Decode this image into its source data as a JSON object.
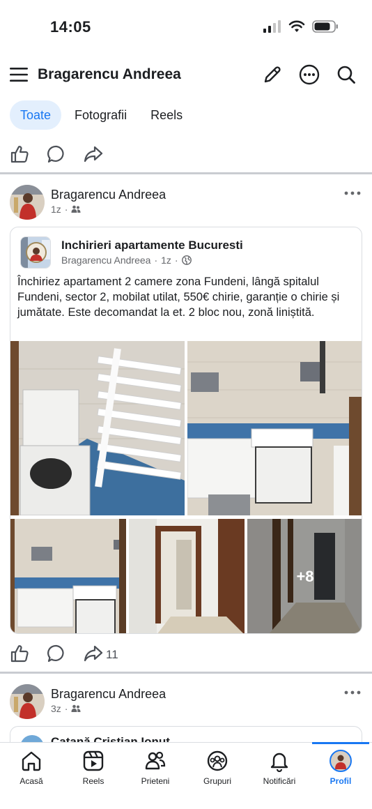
{
  "status_bar": {
    "time": "14:05"
  },
  "header": {
    "title": "Bragarencu Andreea"
  },
  "filter_tabs": [
    {
      "label": "Toate",
      "active": true
    },
    {
      "label": "Fotografii",
      "active": false
    },
    {
      "label": "Reels",
      "active": false
    }
  ],
  "post1": {
    "author": "Bragarencu Andreea",
    "time": "1z",
    "audience_icon": "friends-icon",
    "shared": {
      "group_name": "Inchirieri apartamente Bucuresti",
      "author": "Bragarencu Andreea",
      "time": "1z",
      "audience_icon": "globe-icon",
      "text": "Închiriez apartament 2 camere zona Fundeni, lângă spitalul Fundeni, sector 2, mobilat utilat, 550€ chirie, garanție o chirie și jumătate. Este decomandat la et. 2 bloc nou, zonă liniștită.",
      "more_photos": "+8"
    },
    "share_count": "11"
  },
  "post2": {
    "author": "Bragarencu Andreea",
    "time": "3z",
    "audience_icon": "friends-icon",
    "shared_author": "Catană Cristian Ionuț"
  },
  "bottom_nav": [
    {
      "label": "Acasă",
      "icon": "home-icon"
    },
    {
      "label": "Reels",
      "icon": "reels-icon"
    },
    {
      "label": "Prieteni",
      "icon": "friends-icon"
    },
    {
      "label": "Grupuri",
      "icon": "groups-icon"
    },
    {
      "label": "Notificări",
      "icon": "bell-icon"
    },
    {
      "label": "Profil",
      "icon": "profile-avatar",
      "active": true
    }
  ],
  "colors": {
    "accent": "#1877f2",
    "tab_active_bg": "#e3effd",
    "text": "#1c1e21",
    "meta": "#65676b"
  }
}
